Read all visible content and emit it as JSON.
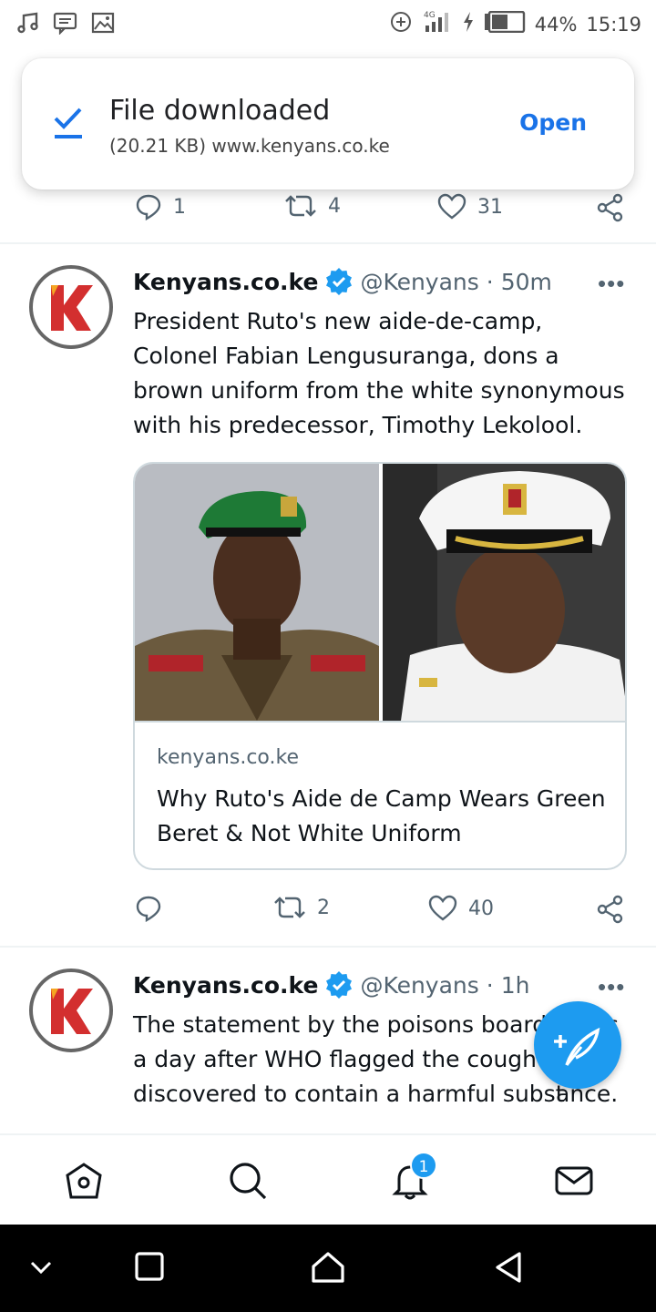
{
  "status_bar": {
    "left_icons": [
      "music-note-icon",
      "message-icon",
      "image-icon"
    ],
    "battery_percent": "44%",
    "time": "15:19",
    "network": "4G"
  },
  "toast": {
    "title": "File downloaded",
    "subtitle": "(20.21 KB) www.kenyans.co.ke",
    "action": "Open"
  },
  "prev_tweet_actions": {
    "replies": "1",
    "retweets": "4",
    "likes": "31"
  },
  "tweets": [
    {
      "name": "Kenyans.co.ke",
      "handle": "@Kenyans",
      "time": "· 50m",
      "text": "President Ruto's new aide-de-camp, Colonel Fabian Lengusuranga, dons a brown uniform from the white synonymous with his predecessor, Timothy Lekolool.",
      "card": {
        "domain": "kenyans.co.ke",
        "title": "Why Ruto's Aide de Camp Wears Green Beret & Not White Uniform"
      },
      "replies": "",
      "retweets": "2",
      "likes": "40"
    },
    {
      "name": "Kenyans.co.ke",
      "handle": "@Kenyans",
      "time": "· 1h",
      "text_lines": [
        "The statement by the poisons board",
        "a day after WHO flagged the cough",
        "discovered to contain a harmful subst"
      ],
      "text_tail": [
        "s",
        "",
        "ance."
      ]
    }
  ],
  "bottom_nav": {
    "items": [
      "home-icon",
      "search-icon",
      "notifications-icon",
      "messages-icon"
    ],
    "notification_badge": "1"
  },
  "colors": {
    "accent": "#1d9bf0",
    "link_blue": "#1a73e8",
    "muted": "#536471",
    "brand_red": "#d32f2f"
  }
}
